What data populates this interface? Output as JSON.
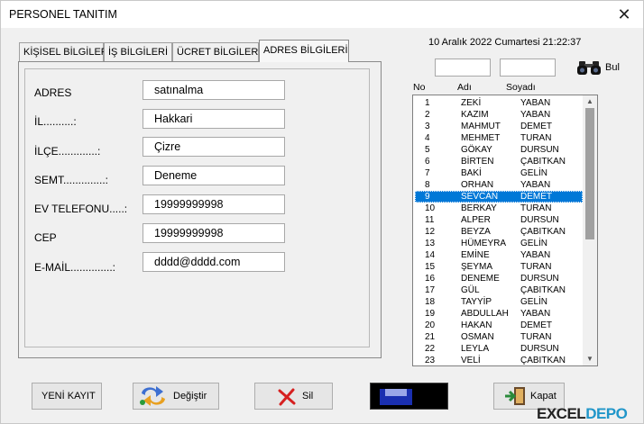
{
  "window": {
    "title": "PERSONEL TANITIM",
    "close_glyph": "✕"
  },
  "tabs": [
    {
      "label": "KİŞİSEL BİLGİLER",
      "active": false
    },
    {
      "label": "İŞ BİLGİLERİ",
      "active": false
    },
    {
      "label": "ÜCRET BİLGİLERİ",
      "active": false
    },
    {
      "label": "ADRES BİLGİLERİ",
      "active": true
    }
  ],
  "form": {
    "fields": [
      {
        "label": "ADRES",
        "value": "satınalma"
      },
      {
        "label": "İL..........:",
        "value": "Hakkari"
      },
      {
        "label": "İLÇE.............:",
        "value": "Çizre"
      },
      {
        "label": "SEMT..............:",
        "value": "Deneme"
      },
      {
        "label": "EV TELEFONU.....:",
        "value": "19999999998"
      },
      {
        "label": "CEP",
        "value": "19999999998"
      },
      {
        "label": "E-MAİL..............:",
        "value": "dddd@dddd.com"
      }
    ]
  },
  "search": {
    "datetime": "10 Aralık 2022 Cumartesi 21:22:37",
    "input1": "",
    "input2": "",
    "find_label": "Bul",
    "find_icon": "binoculars-icon"
  },
  "list": {
    "headers": [
      "No",
      "Adı",
      "Soyadı"
    ],
    "selected_index": 8,
    "rows": [
      [
        "1",
        "ZEKİ",
        "YABAN"
      ],
      [
        "2",
        "KAZIM",
        "YABAN"
      ],
      [
        "3",
        "MAHMUT",
        "DEMET"
      ],
      [
        "4",
        "MEHMET",
        "TURAN"
      ],
      [
        "5",
        "GÖKAY",
        "DURSUN"
      ],
      [
        "6",
        "BİRTEN",
        "ÇABITKAN"
      ],
      [
        "7",
        "BAKİ",
        "GELİN"
      ],
      [
        "8",
        "ORHAN",
        "YABAN"
      ],
      [
        "9",
        "SEVCAN",
        "DEMET"
      ],
      [
        "10",
        "BERKAY",
        "TURAN"
      ],
      [
        "11",
        "ALPER",
        "DURSUN"
      ],
      [
        "12",
        "BEYZA",
        "ÇABITKAN"
      ],
      [
        "13",
        "HÜMEYRA",
        "GELİN"
      ],
      [
        "14",
        "EMİNE",
        "YABAN"
      ],
      [
        "15",
        "ŞEYMA",
        "TURAN"
      ],
      [
        "16",
        "DENEME",
        "DURSUN"
      ],
      [
        "17",
        "GÜL",
        "ÇABITKAN"
      ],
      [
        "18",
        "TAYYİP",
        "GELİN"
      ],
      [
        "19",
        "ABDULLAH",
        "YABAN"
      ],
      [
        "20",
        "HAKAN",
        "DEMET"
      ],
      [
        "21",
        "OSMAN",
        "TURAN"
      ],
      [
        "22",
        "LEYLA",
        "DURSUN"
      ],
      [
        "23",
        "VELİ",
        "ÇABITKAN"
      ]
    ]
  },
  "buttons": {
    "new": "YENİ KAYIT",
    "change": "Değiştir",
    "delete": "Sil",
    "close": "Kapat"
  },
  "watermark": {
    "part1": "EXCEL",
    "part2": "DEPO"
  },
  "colors": {
    "selection": "#0078d7",
    "watermark_accent": "#2196c9",
    "delete_icon": "#d62020"
  }
}
